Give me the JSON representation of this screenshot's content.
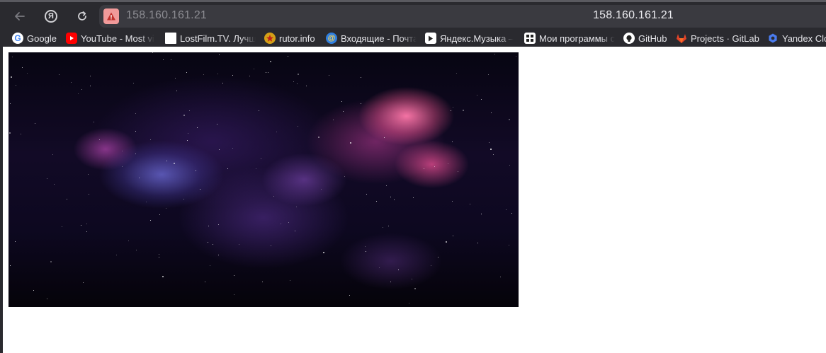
{
  "browser": {
    "url": "158.160.161.21",
    "page_title": "158.160.161.21",
    "icons": {
      "back": "back-arrow-icon",
      "yandex": "yandex-icon",
      "reload": "reload-icon",
      "security": "warning-icon"
    },
    "colors": {
      "chrome_bg": "#2a2a2f",
      "address_bar_bg": "#3a3a40",
      "warning_badge": "#f19a9a",
      "warning_mark": "#c0302b",
      "page_bg": "#ffffff"
    }
  },
  "bookmarks": [
    {
      "label": "Google",
      "icon": "google-icon"
    },
    {
      "label": "YouTube - Most vi",
      "icon": "youtube-icon"
    },
    {
      "label": "LostFilm.TV. Лучш",
      "icon": "blank-page-icon"
    },
    {
      "label": "rutor.info",
      "icon": "star-badge-icon"
    },
    {
      "label": "Входящие - Почта",
      "icon": "mail-icon"
    },
    {
      "label": "Яндекс.Музыка –",
      "icon": "play-icon"
    },
    {
      "label": "Мои программы с",
      "icon": "grid-icon"
    },
    {
      "label": "GitHub",
      "icon": "github-icon"
    },
    {
      "label": "Projects · GitLab",
      "icon": "gitlab-icon"
    },
    {
      "label": "Yandex Clo",
      "icon": "yandex-cloud-icon"
    }
  ],
  "page": {
    "image_subject": "space-nebula-image"
  }
}
